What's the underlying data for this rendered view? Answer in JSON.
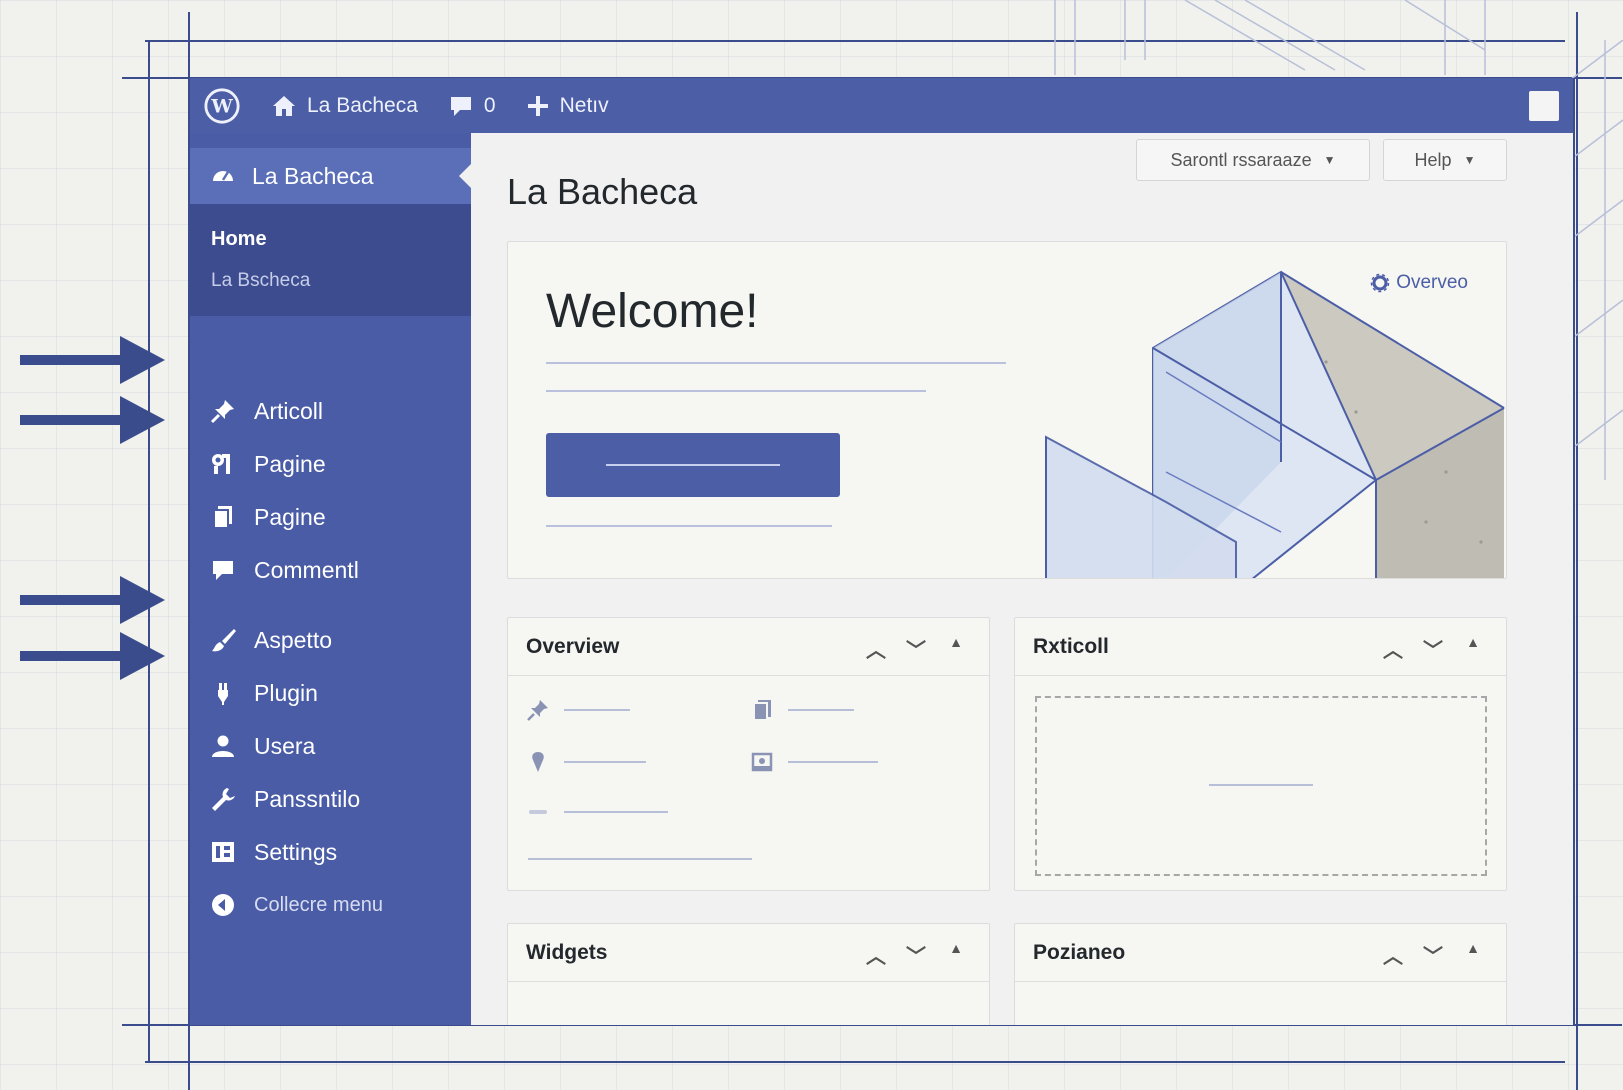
{
  "adminbar": {
    "site_name": "La Bacheca",
    "comment_count": "0",
    "new_label": "Netıv"
  },
  "sidebar": {
    "current": {
      "label": "La Bacheca",
      "icon": "dashboard-icon"
    },
    "submenu": {
      "home": "Home",
      "dashboard": "La Bscheca"
    },
    "items": [
      {
        "label": "Articoll",
        "icon": "pin-icon"
      },
      {
        "label": "Pagine",
        "icon": "media-icon"
      },
      {
        "label": "Pagine",
        "icon": "pages-icon"
      },
      {
        "label": "Commentl",
        "icon": "comment-icon"
      },
      {
        "label": "Aspetto",
        "icon": "brush-icon"
      },
      {
        "label": "Plugin",
        "icon": "plugin-icon"
      },
      {
        "label": "Usera",
        "icon": "user-icon"
      },
      {
        "label": "Panssntilo",
        "icon": "wrench-icon"
      },
      {
        "label": "Settings",
        "icon": "settings-icon"
      },
      {
        "label": "Collecre menu",
        "icon": "collapse-icon"
      }
    ]
  },
  "main": {
    "title": "La Bacheca",
    "screen_options": "Sarontl rssaraaze",
    "help": "Help",
    "welcome": {
      "title": "Welcome!",
      "overview_link": "Overveo"
    },
    "panels": {
      "overview": "Overview",
      "articoli": "Rxticoll",
      "widgets": "Widgets",
      "pozianeo": "Pozianeo"
    }
  },
  "colors": {
    "accent": "#4b5ea6",
    "sidebar": "#4a5ca6",
    "submenu": "#3d4c8e",
    "frame": "#3a4c8c"
  }
}
